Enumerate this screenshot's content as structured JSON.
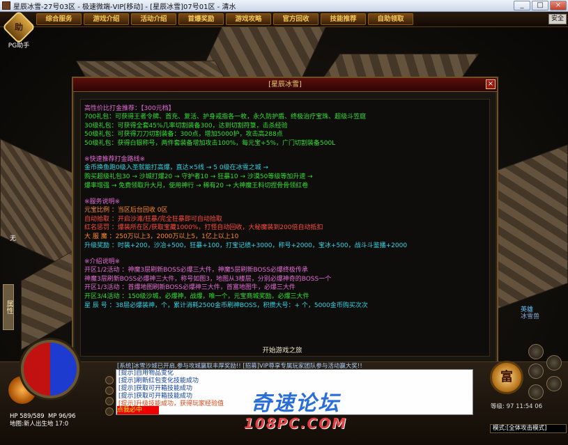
{
  "window": {
    "title": "星辰冰雪-27号03区 - 极速微端-VIP[移动] - [星辰冰雪]07号01区 - 清水",
    "buttons": [
      "_",
      "□",
      "×"
    ]
  },
  "topbar": {
    "tabs": [
      "综合服务",
      "游戏介绍",
      "活动介绍",
      "首爆奖励",
      "游戏攻略",
      "官方回收",
      "技能推荐",
      "自助领取"
    ],
    "safe_button": "安全"
  },
  "pg_helper": {
    "badge": "助",
    "label": "PG助手"
  },
  "side_tab": "属性",
  "player_name_left": "无",
  "npc_right": [
    "英雄",
    "冰雪兽"
  ],
  "dialog": {
    "title": "[星辰冰雪]",
    "close": "×",
    "sections": [
      {
        "heading": "高性价比打金推荐：【300元档】",
        "heading_color": "#e36bd6",
        "lines": [
          {
            "text": "700礼包：可获得王者令牌、首充、复活、护身戒指各一枚，永久防护盾、终极治疗宝珠、超级斗笠庭",
            "color": "#2fe02f"
          },
          {
            "text": "30级礼包：可获得全套45%几率切割装备300，达到切割符箓，击杀经验",
            "color": "#2fe02f"
          },
          {
            "text": "50级礼包：可获得刀刀切割装备：300点，增加5000护，攻击高288点",
            "color": "#2fe02f"
          },
          {
            "text": "50级礼包：获得白银称号，两件套装备增加攻击100%，每元宝+5%，广门切割装备500L",
            "color": "#2fe02f"
          }
        ]
      },
      {
        "heading": "※快速推荐打金路线※",
        "heading_color": "#e36bd6",
        "lines": [
          {
            "text": "金币换鱼跑0级入圣就能打高爆，直达×5线 → 5 0级在冰雪之城 →",
            "color": "#2fd6e6"
          },
          {
            "text": "购买超级礼包30 → 沙城打爆20 → 守护者10 → 狂暴10 → 沙漠50等级等加升速 →",
            "color": "#2fe02f"
          },
          {
            "text": "爆率增强 → 免费领取升大月，使用神行 → 稀有20 → 大神魔王料切捏骨骨领红卷",
            "color": "#2fe02f"
          }
        ]
      },
      {
        "heading": "※服务说明※",
        "heading_color": "#e36bd6",
        "lines": [
          {
            "text": "元宝比例 ：当区后台回收 0区",
            "color": "#ff8a2a"
          },
          {
            "text": "自动拾取 ：开启沙滩/狂暴/完全狂暴即可自动拾取",
            "color": "#ff4b3a"
          },
          {
            "text": "红名惩罚 ：爆装所在区/获取宝藏1000%，打怪自动回收，大秘魔装到200倍自动抵扣",
            "color": "#ff4b3a"
          },
          {
            "text": "大 服 魔 ：250万以上3，2000万以上5，1亿上以上10",
            "color": "#ff8a2a"
          },
          {
            "text": "升级奖励 ：时装+200，沙冶+500，狂暴+100，打宝记绩+3000，称号+2000，宝冰+500，战斗斗鉴播+2000",
            "color": "#2fd6e6"
          }
        ]
      },
      {
        "heading": "※介绍说明※",
        "heading_color": "#e36bd6",
        "lines": [
          {
            "text": "开区1/2活动 ：神魔3层刷新BOSS必爆三大件，神魔5层刷新BOSS必爆终极传承",
            "color": "#e36bd6"
          },
          {
            "text": "           神魔3层刷新BOSS必爆神三大件，称号如图3，地图从3楼层，分别必爆神奇的BOSS一个",
            "color": "#e36bd6"
          },
          {
            "text": "开区1/3活动 ：首爆地图刷新BOSS必爆神三大件，首富地图牛，必爆三大件",
            "color": "#e36bd6"
          },
          {
            "text": "开区3/4活动 ：150级沙城，必爆神，战爆，唯一个，元宝商城奖励，必爆三大件",
            "color": "#2fe02f"
          },
          {
            "text": "星 辰 号 ：38层必爆装神，个，累计消耗2500金币刷神BOSS，积攒大号：+ 个，5000金币购买次次",
            "color": "#2fd6e6"
          }
        ]
      }
    ],
    "start_button": "开始游戏之旅"
  },
  "chat": {
    "topline": "[系统]冰雪沙城已开启,参与攻城赢取丰厚奖励!! [招募]VIP尊享专属玩家团队参与活动赢大奖!!",
    "lines": [
      {
        "text": "[提示]自用物品变化",
        "color": "#0a3aa0"
      },
      {
        "text": "[提示]刷新红包变化技能成功",
        "color": "#0a3aa0"
      },
      {
        "text": "[提示]获取可开箱技能成功",
        "color": "#0a3aa0"
      },
      {
        "text": "[提示]获取可开箱技能成功",
        "color": "#0a3aa0"
      },
      {
        "text": "[提示]升级技能成功，获得玩家经验值",
        "color": "#d41"
      }
    ],
    "input_value": "点我必中"
  },
  "player_stats": {
    "hp": "HP 589/589",
    "mp": "MP 96/96",
    "location": "地图:新人出生地 17:0"
  },
  "right_panel": {
    "action_label": "富",
    "info": "等级: 97    11:54 06",
    "mode": "模式:[全体攻击模式]"
  },
  "watermark": {
    "main": "奇速论坛",
    "sub": "108PC.COM"
  },
  "colors": {
    "menu_text": "#f3c654",
    "dialog_border": "#6e5226",
    "hp_red": "#c21111",
    "mp_blue": "#1d3ccf"
  }
}
